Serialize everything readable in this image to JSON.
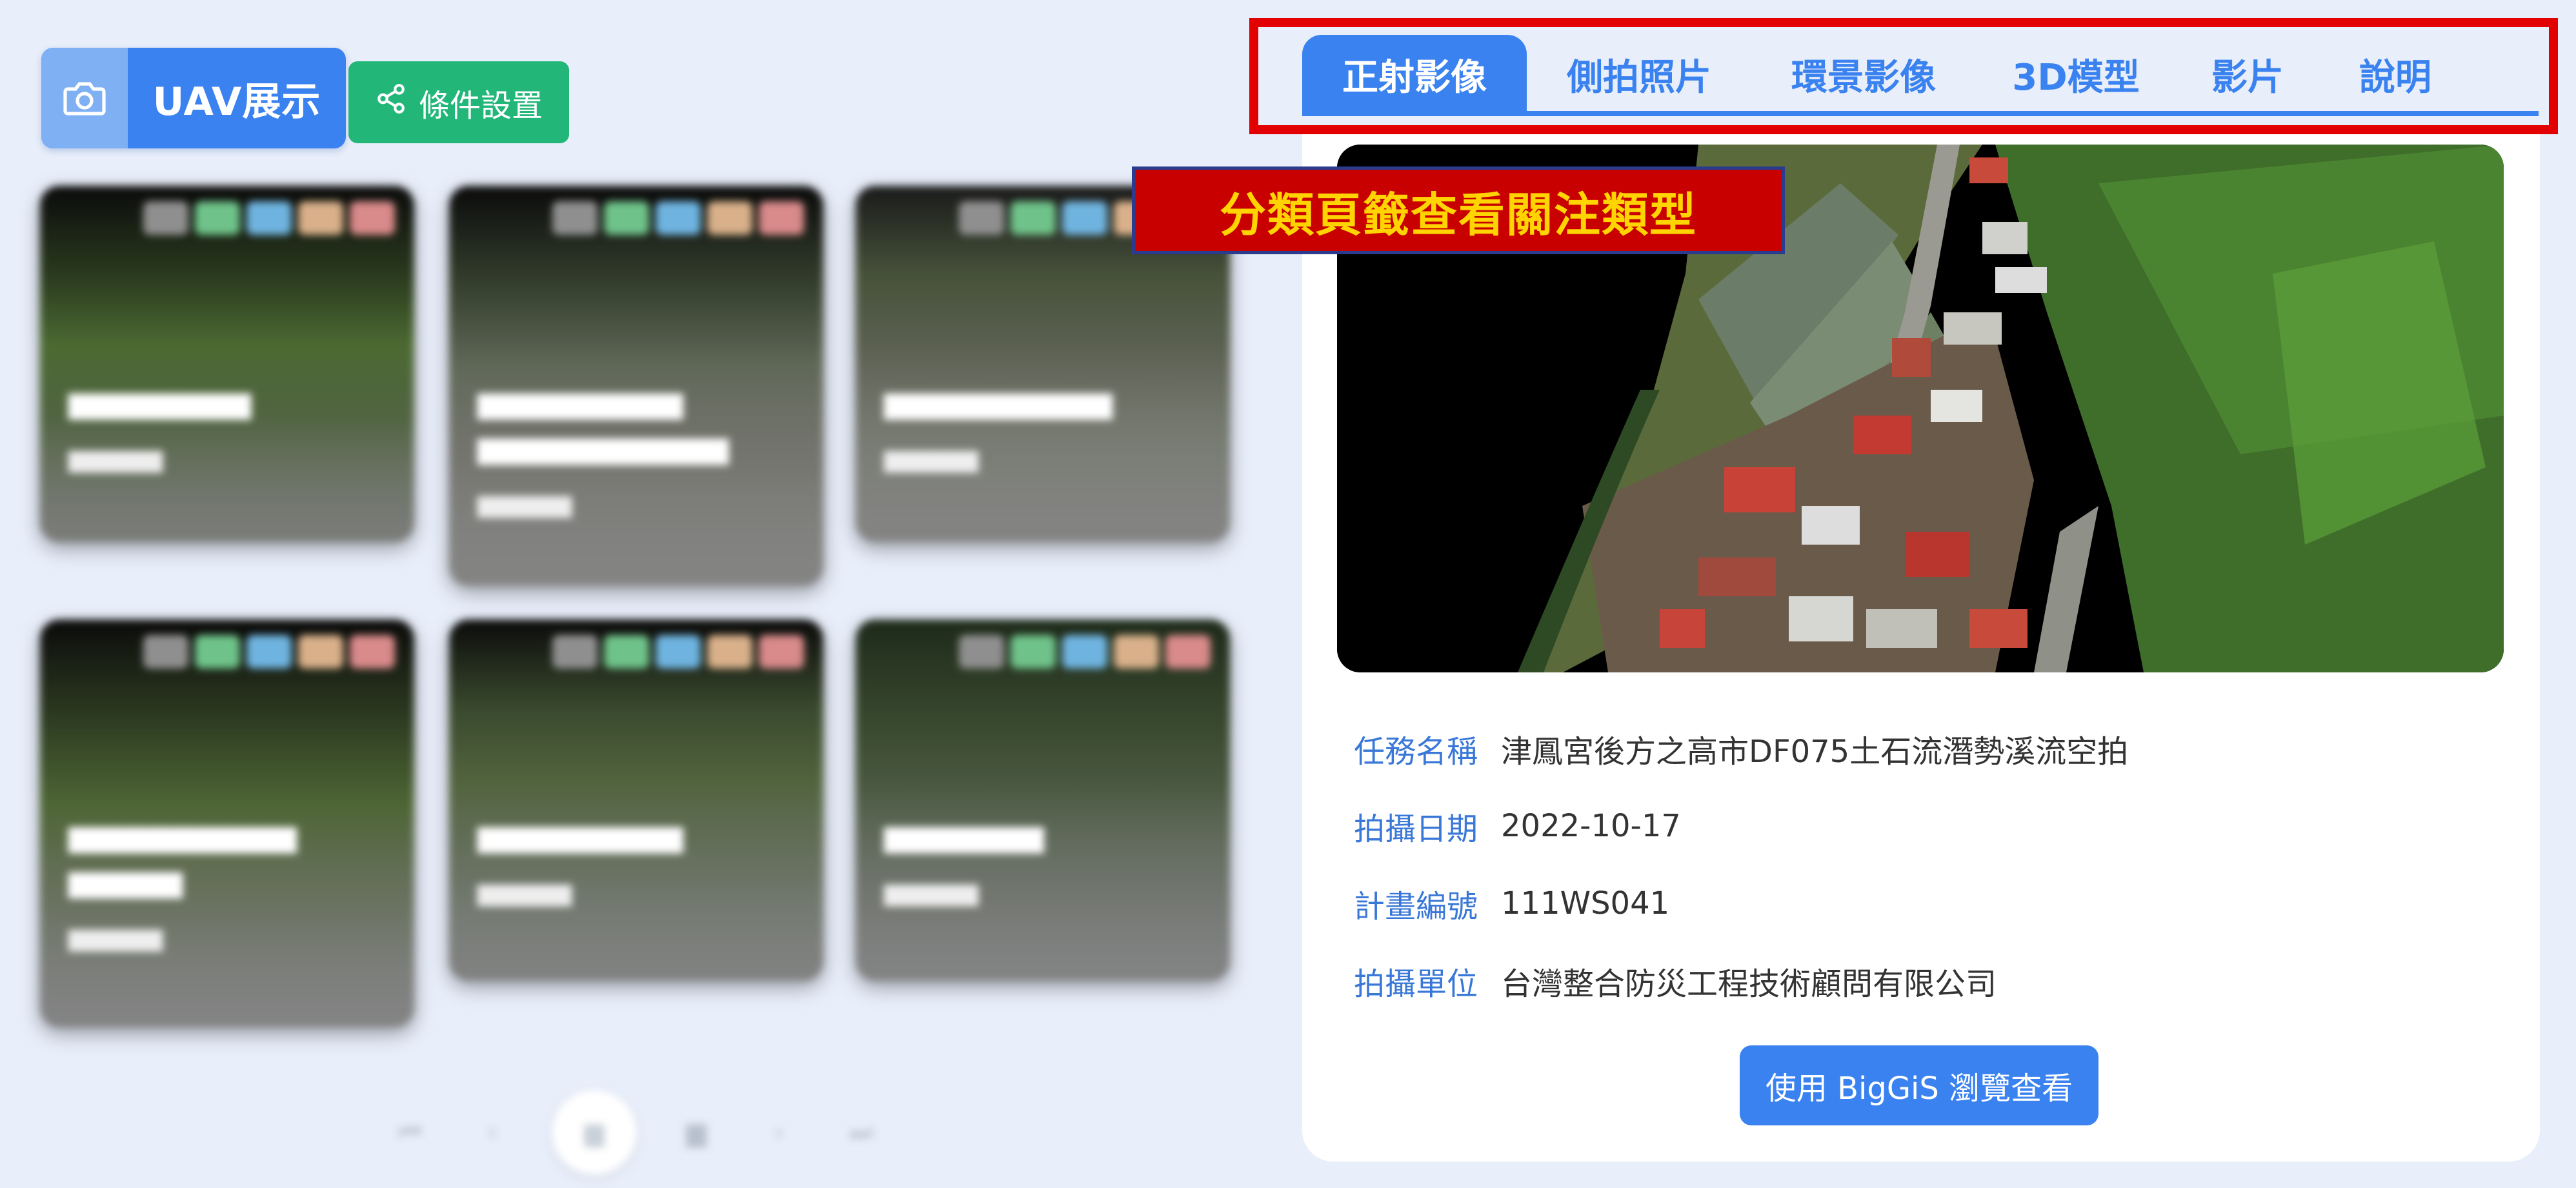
{
  "header": {
    "title": "UAV展示",
    "conditions_button": "條件設置"
  },
  "tabs": [
    {
      "label": "正射影像",
      "active": true
    },
    {
      "label": "側拍照片",
      "active": false
    },
    {
      "label": "環景影像",
      "active": false
    },
    {
      "label": "3D模型",
      "active": false
    },
    {
      "label": "影片",
      "active": false
    },
    {
      "label": "說明",
      "active": false
    }
  ],
  "callout": "分類頁籤查看關注類型",
  "detail": {
    "fields": [
      {
        "label": "任務名稱",
        "value": "津鳳宮後方之高市DF075土石流潛勢溪流空拍"
      },
      {
        "label": "拍攝日期",
        "value": "2022-10-17"
      },
      {
        "label": "計畫編號",
        "value": "111WS041"
      },
      {
        "label": "拍攝單位",
        "value": "台灣整合防災工程技術顧問有限公司"
      }
    ],
    "view_button": "使用 BigGiS 瀏覽查看"
  },
  "colors": {
    "accent": "#3a82f0",
    "green_button": "#22b679",
    "highlight_frame": "#e30000",
    "callout_bg": "#c80000",
    "callout_text": "#ffd400",
    "page_bg": "#e8eefa"
  }
}
